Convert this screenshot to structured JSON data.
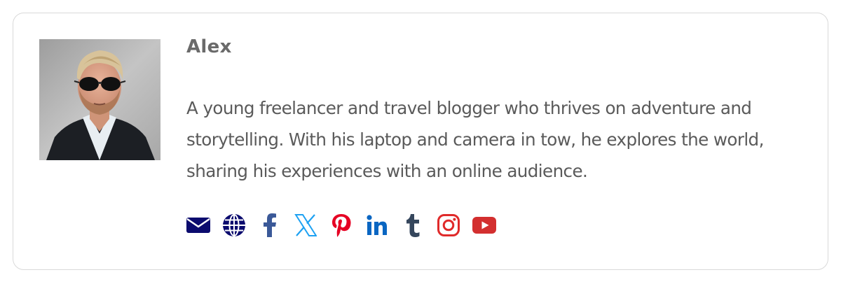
{
  "author": {
    "name": "Alex",
    "bio": "A young freelancer and travel blogger who thrives on adventure and storytelling. With his laptop and camera in tow, he explores the world, sharing his experiences with an online audience."
  },
  "social_links": [
    {
      "icon": "email-icon",
      "color": "#0b0b6e"
    },
    {
      "icon": "globe-icon",
      "color": "#0b0b6e"
    },
    {
      "icon": "facebook-icon",
      "color": "#3b5998"
    },
    {
      "icon": "x-twitter-icon",
      "color": "#1da1f2"
    },
    {
      "icon": "pinterest-icon",
      "color": "#e60023"
    },
    {
      "icon": "linkedin-icon",
      "color": "#0a66c2"
    },
    {
      "icon": "tumblr-icon",
      "color": "#35465c"
    },
    {
      "icon": "instagram-icon",
      "color": "#e1306c"
    },
    {
      "icon": "youtube-icon",
      "color": "#d32f2f"
    }
  ]
}
